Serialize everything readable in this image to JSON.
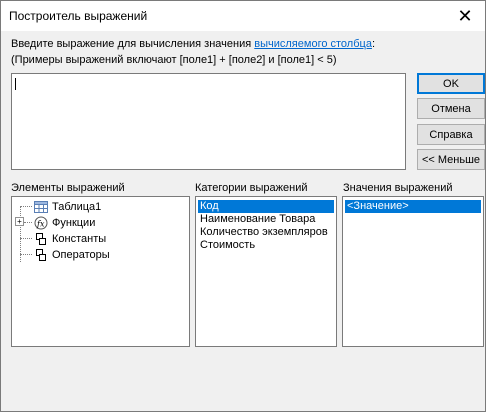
{
  "window": {
    "title": "Построитель выражений",
    "close_symbol": "✕"
  },
  "instructions": {
    "line1_prefix": "Введите выражение для вычисления значения ",
    "line1_link": "вычисляемого столбца",
    "line1_suffix": ":",
    "line2": "(Примеры выражений включают [поле1] + [поле2] и [поле1] < 5)"
  },
  "expression": {
    "value": ""
  },
  "buttons": {
    "ok": "OK",
    "cancel": "Отмена",
    "help": "Справка",
    "less": "<< Меньше"
  },
  "panes": {
    "elements_label": "Элементы выражений",
    "categories_label": "Категории выражений",
    "values_label": "Значения выражений"
  },
  "tree": {
    "items": [
      {
        "label": "Таблица1",
        "icon": "table-icon",
        "expandable": false
      },
      {
        "label": "Функции",
        "icon": "function-icon",
        "expandable": true
      },
      {
        "label": "Константы",
        "icon": "constants-icon",
        "expandable": false
      },
      {
        "label": "Операторы",
        "icon": "operators-icon",
        "expandable": false
      }
    ]
  },
  "categories": {
    "items": [
      "Код",
      "Наименование Товара",
      "Количество экземпляров",
      "Стоимость"
    ],
    "selected_index": 0
  },
  "values": {
    "items": [
      "<Значение>"
    ],
    "selected_index": 0
  },
  "colors": {
    "selection": "#0078d7",
    "link": "#0066cc"
  }
}
